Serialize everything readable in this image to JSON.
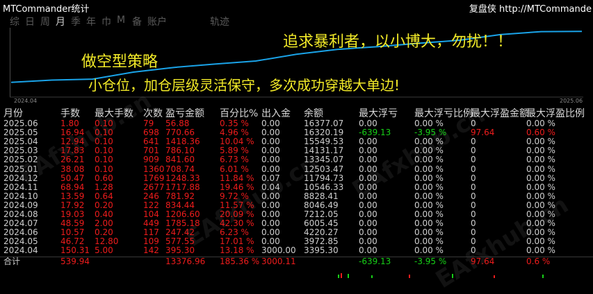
{
  "title": "MTCommander统计",
  "site": "复盘侠 http://MTCommande",
  "tabs": [
    "综",
    "日",
    "周",
    "月",
    "季",
    "年",
    "巾",
    "M",
    "备",
    "账户",
    "轨迹"
  ],
  "active_tab": 3,
  "chart": {
    "start_label": "2024.04",
    "end_label": "2025.06",
    "balance": [
      3395.3,
      3972.85,
      4220.27,
      6005.45,
      7212.05,
      8046.49,
      8828.41,
      10546.33,
      11794.73,
      12503.47,
      13345.07,
      14131.17,
      15549.53,
      16320.19,
      16377.07
    ],
    "line_color": "#1aa3e8"
  },
  "overlay": {
    "line1": "追求暴利者，以小博大，勿扰！！",
    "line2": "做空型策略",
    "line3": "小仓位，加仓层级灵活保守，多次成功穿越大单边!"
  },
  "watermark": "EAfxhub.cn",
  "headers": [
    "月份",
    "手数",
    "最大手数",
    "次数",
    "盈亏金额",
    "百分比%",
    "出入金",
    "余额",
    "最大浮亏",
    "最大浮亏比例",
    "最大浮盈金额",
    "最大浮盈比例"
  ],
  "rows": [
    [
      "2025.06",
      "1.80",
      "0.10",
      "79",
      "56.88",
      "0.35 %",
      "0.00",
      "16377.07",
      "0.00",
      "0.00 %",
      "0",
      "0.00 %"
    ],
    [
      "2025.05",
      "16.94",
      "0.10",
      "698",
      "770.66",
      "4.96 %",
      "0.00",
      "16320.19",
      "-639.13",
      "-3.95 %",
      "97.64",
      "0.60 %"
    ],
    [
      "2025.04",
      "12.94",
      "0.10",
      "641",
      "1418.36",
      "10.04 %",
      "0.00",
      "15549.53",
      "0.00",
      "0.00 %",
      "0",
      "0.00 %"
    ],
    [
      "2025.03",
      "17.83",
      "0.10",
      "701",
      "786.10",
      "5.89 %",
      "0.00",
      "14131.17",
      "0.00",
      "0.00 %",
      "0",
      "0.00 %"
    ],
    [
      "2025.02",
      "26.21",
      "0.10",
      "909",
      "841.60",
      "6.73 %",
      "0.00",
      "13345.07",
      "0.00",
      "0.00 %",
      "0",
      "0.00 %"
    ],
    [
      "2025.01",
      "38.08",
      "0.10",
      "1360",
      "708.74",
      "6.01 %",
      "0.00",
      "12503.47",
      "0.00",
      "0.00 %",
      "0",
      "0.00 %"
    ],
    [
      "2024.12",
      "50.47",
      "0.60",
      "1769",
      "1248.33",
      "11.84 %",
      "0.07",
      "11794.73",
      "0.00",
      "0.00 %",
      "0",
      "0.00 %"
    ],
    [
      "2024.11",
      "68.94",
      "1.28",
      "2677",
      "1717.88",
      "19.46 %",
      "0.04",
      "10546.33",
      "0.00",
      "0.00 %",
      "0",
      "0.00 %"
    ],
    [
      "2024.10",
      "13.59",
      "0.64",
      "246",
      "781.92",
      "9.72 %",
      "0.00",
      "8828.41",
      "0.00",
      "0.00 %",
      "0",
      "0.00 %"
    ],
    [
      "2024.09",
      "17.92",
      "0.20",
      "122",
      "834.44",
      "11.57 %",
      "0.00",
      "8046.49",
      "0.00",
      "0.00 %",
      "0",
      "0.00 %"
    ],
    [
      "2024.08",
      "19.03",
      "0.40",
      "104",
      "1206.60",
      "20.09 %",
      "0.00",
      "7212.05",
      "0.00",
      "0.00 %",
      "0",
      "0.00 %"
    ],
    [
      "2024.07",
      "48.59",
      "2.00",
      "449",
      "1785.18",
      "42.30 %",
      "0.00",
      "6005.45",
      "0.00",
      "0.00 %",
      "0",
      "0.00 %"
    ],
    [
      "2024.06",
      "10.57",
      "0.20",
      "117",
      "247.42",
      "6.23 %",
      "0.00",
      "4220.27",
      "0.00",
      "0.00 %",
      "0",
      "0.00 %"
    ],
    [
      "2024.05",
      "46.72",
      "12.80",
      "109",
      "577.55",
      "17.01 %",
      "0.00",
      "3972.85",
      "0.00",
      "0.00 %",
      "0",
      "0.00 %"
    ],
    [
      "2024.04",
      "150.31",
      "5.00",
      "142",
      "395.30",
      "13.18 %",
      "3000.00",
      "3395.30",
      "0.00",
      "0.00 %",
      "0",
      "0.00 %"
    ]
  ],
  "total": [
    "合计",
    "539.94",
    "",
    "",
    "13376.96",
    "185.36 %",
    "3000.11",
    "",
    "-639.13",
    "-3.95 %",
    "97.64",
    "0.6 %"
  ],
  "colors": {
    "label": "#cfcfcf",
    "value": "#ee1c1c",
    "negative": "#17d017",
    "highlight": "#f2ea28"
  }
}
